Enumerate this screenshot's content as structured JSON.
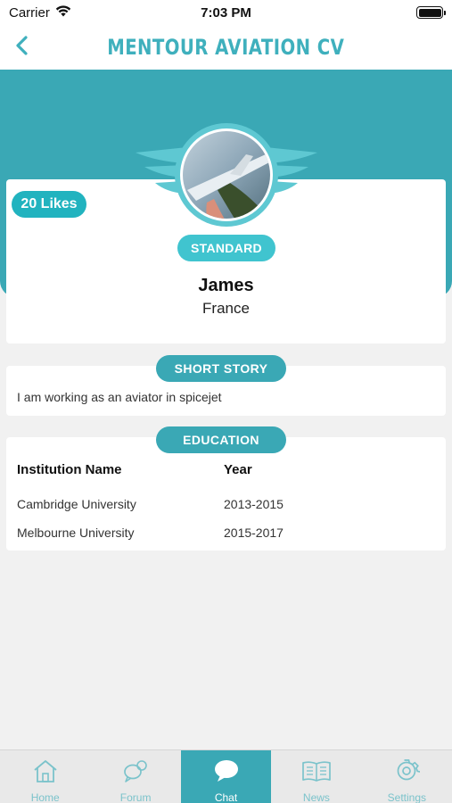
{
  "status_bar": {
    "carrier": "Carrier",
    "time": "7:03 PM"
  },
  "nav": {
    "title": "MENTOUR AVIATION CV",
    "back_icon": "chevron-left-icon"
  },
  "profile": {
    "likes": "20 Likes",
    "tier": "STANDARD",
    "name": "James",
    "country": "France"
  },
  "short_story": {
    "heading": "SHORT STORY",
    "text": "I am working as an aviator in spicejet"
  },
  "education": {
    "heading": "EDUCATION",
    "columns": [
      "Institution Name",
      "Year"
    ],
    "rows": [
      {
        "institution": "Cambridge University",
        "year": "2013-2015"
      },
      {
        "institution": "Melbourne University",
        "year": "2015-2017"
      }
    ]
  },
  "tabs": [
    {
      "label": "Home",
      "icon": "home-icon",
      "active": false
    },
    {
      "label": "Forum",
      "icon": "forum-icon",
      "active": false
    },
    {
      "label": "Chat",
      "icon": "chat-icon",
      "active": true
    },
    {
      "label": "News",
      "icon": "news-icon",
      "active": false
    },
    {
      "label": "Settings",
      "icon": "settings-icon",
      "active": false
    }
  ],
  "colors": {
    "accent": "#3aa8b5",
    "likes_badge": "#21b3bf",
    "tier_badge": "#40c4cf",
    "title": "#3fb0bd"
  }
}
